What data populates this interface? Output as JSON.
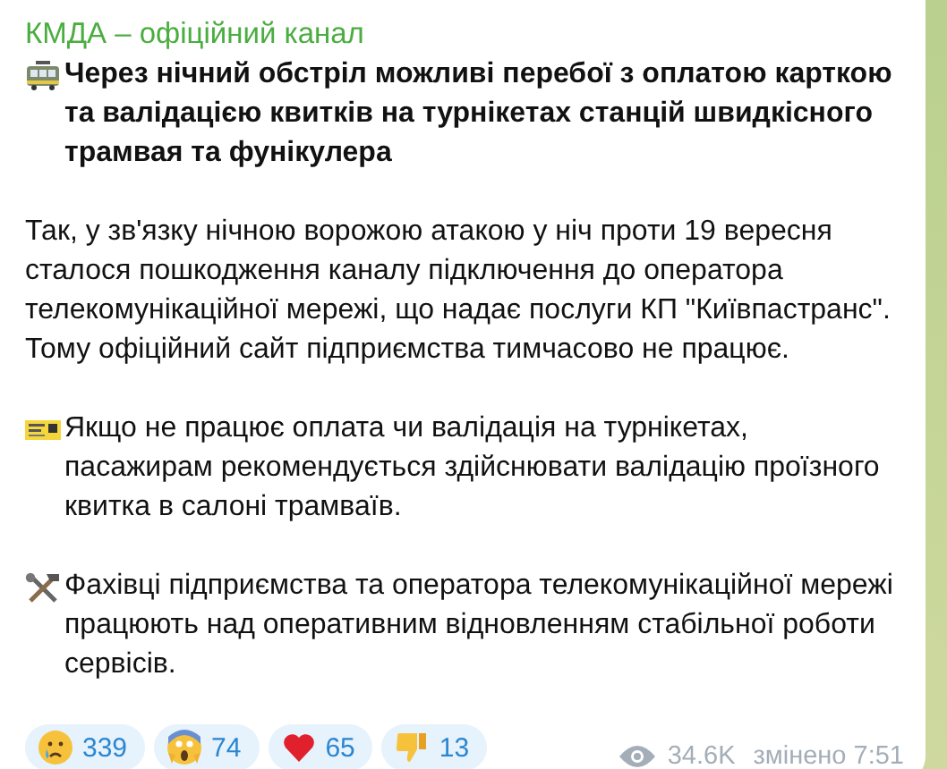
{
  "channel": {
    "name": "КМДА – офіційний канал"
  },
  "paragraphs": [
    {
      "kind": "headline",
      "text": "Через нічний обстріл можливі перебої з оплатою карткою та валідацією квитків на турнікетах станцій швидкісного трамвая та фунікулера"
    },
    {
      "kind": "plain",
      "text": "Так, у зв'язку нічною ворожою атакою у ніч проти 19 вересня сталося пошкодження каналу підключення до оператора телекомунікаційної мережі, що надає послуги КП \"Київпастранс\". Тому офіційний сайт підприємства тимчасово не працює."
    },
    {
      "kind": "plain",
      "text": "Якщо не працює оплата чи валідація на турнікетах, пасажирам рекомендується здійснювати валідацію проїзного квитка в салоні трамваїв."
    },
    {
      "kind": "plain",
      "text": "Фахівці підприємства та оператора телекомунікаційної мережі працюють над оперативним відновленням стабільної роботи сервісів."
    }
  ],
  "reactions": [
    {
      "count": "339",
      "selected": false
    },
    {
      "count": "74",
      "selected": false
    },
    {
      "count": "65",
      "selected": false
    },
    {
      "count": "13",
      "selected": false
    }
  ],
  "footer": {
    "views": "34.6K",
    "status": "змінено 7:51"
  }
}
